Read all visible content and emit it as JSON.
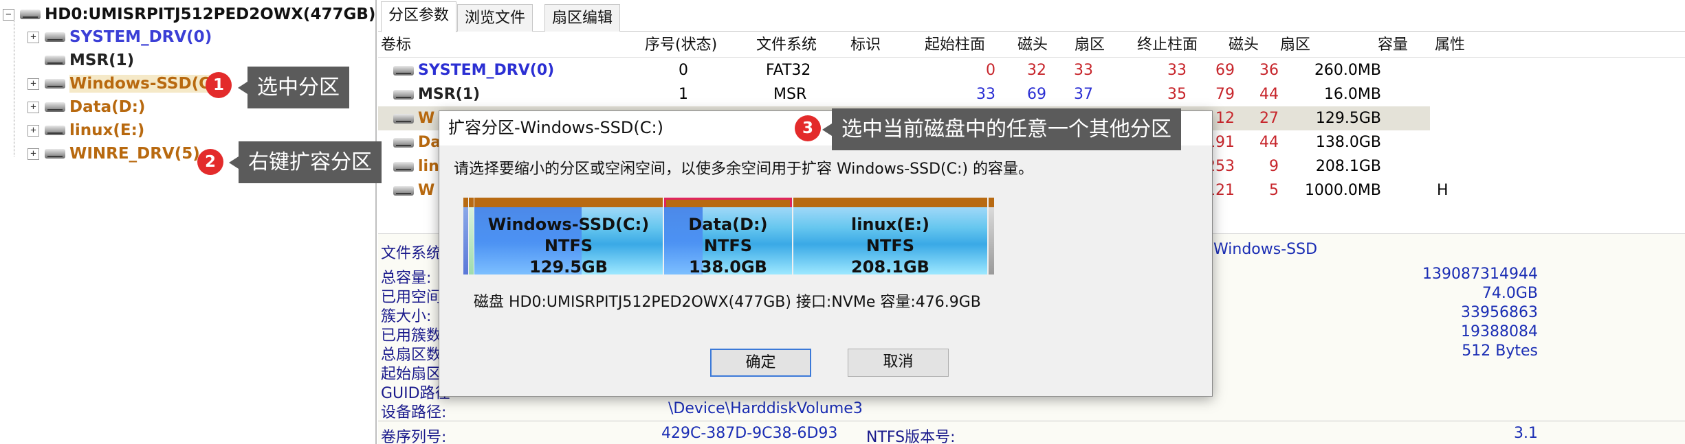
{
  "tree": {
    "disk": "HD0:UMISRPITJ512PED2OWX(477GB)",
    "items": [
      {
        "label": "SYSTEM_DRV(0)",
        "color": "#3b3fd6"
      },
      {
        "label": "MSR(1)",
        "color": "#222222"
      },
      {
        "label": "Windows-SSD(C:)",
        "color": "#b8690f"
      },
      {
        "label": "Data(D:)",
        "color": "#b8690f"
      },
      {
        "label": "linux(E:)",
        "color": "#b8690f"
      },
      {
        "label": "WINRE_DRV(5)",
        "color": "#b8690f"
      }
    ]
  },
  "tabs": [
    "分区参数",
    "浏览文件",
    "扇区编辑"
  ],
  "columns": [
    "卷标",
    "序号(状态)",
    "文件系统",
    "标识",
    "起始柱面",
    "磁头",
    "扇区",
    "终止柱面",
    "磁头",
    "扇区",
    "容量",
    "属性"
  ],
  "partitions": [
    {
      "name": "SYSTEM_DRV(0)",
      "index": "0",
      "fs": "FAT32",
      "start_cyl": "0",
      "start_head": "32",
      "start_sec": "33",
      "end_cyl": "33",
      "end_head": "69",
      "end_sec": "36",
      "size": "260.0MB",
      "attr": ""
    },
    {
      "name": "MSR(1)",
      "index": "1",
      "fs": "MSR",
      "start_cyl": "33",
      "start_head": "69",
      "start_sec": "37",
      "end_cyl": "35",
      "end_head": "79",
      "end_sec": "44",
      "size": "16.0MB",
      "attr": ""
    },
    {
      "name": "W",
      "end_head": "12",
      "end_sec": "27",
      "size": "129.5GB",
      "attr": ""
    },
    {
      "name": "Da",
      "end_head": "191",
      "end_sec": "44",
      "size": "138.0GB",
      "attr": ""
    },
    {
      "name": "lin",
      "end_head": "253",
      "end_sec": "9",
      "size": "208.1GB",
      "attr": ""
    },
    {
      "name": "W",
      "end_head": "121",
      "end_sec": "5",
      "size": "1000.0MB",
      "attr": "H"
    }
  ],
  "info": {
    "fs_label": "文件系统",
    "fs_value": "Windows-SSD",
    "rows": [
      {
        "label": "总容量:",
        "value": "139087314944"
      },
      {
        "label": "已用空间",
        "value": "74.0GB"
      },
      {
        "label": "簇大小:",
        "value": "33956863"
      },
      {
        "label": "已用簇数",
        "value": "19388084"
      },
      {
        "label": "总扇区数",
        "value": "512 Bytes"
      },
      {
        "label": "起始扇区",
        "value": ""
      },
      {
        "label": "GUID路径",
        "value": ""
      }
    ],
    "device_label": "设备路径:",
    "device_value": "\\Device\\HarddiskVolume3",
    "serial_label": "卷序列号:",
    "serial_value": "429C-387D-9C38-6D93",
    "ntfs_label": "NTFS版本号:",
    "ntfs_value": "3.1"
  },
  "dialog": {
    "title": "扩容分区-Windows-SSD(C:)",
    "prompt": "请选择要缩小的分区或空闲空间，以使多余空间用于扩容 Windows-SSD(C:) 的容量。",
    "segments": [
      {
        "name": "Windows-SSD(C:)",
        "fs": "NTFS",
        "size": "129.5GB",
        "used_fraction": 0.57
      },
      {
        "name": "Data(D:)",
        "fs": "NTFS",
        "size": "138.0GB",
        "used_fraction": 0.3
      },
      {
        "name": "linux(E:)",
        "fs": "NTFS",
        "size": "208.1GB",
        "used_fraction": 0.0
      }
    ],
    "disk_info": "磁盘 HD0:UMISRPITJ512PED2OWX(477GB)  接口:NVMe  容量:476.9GB",
    "ok": "确定",
    "cancel": "取消"
  },
  "annotations": [
    {
      "number": "1",
      "text": "选中分区"
    },
    {
      "number": "2",
      "text": "右键扩容分区"
    },
    {
      "number": "3",
      "text": "选中当前磁盘中的任意一个其他分区"
    }
  ]
}
